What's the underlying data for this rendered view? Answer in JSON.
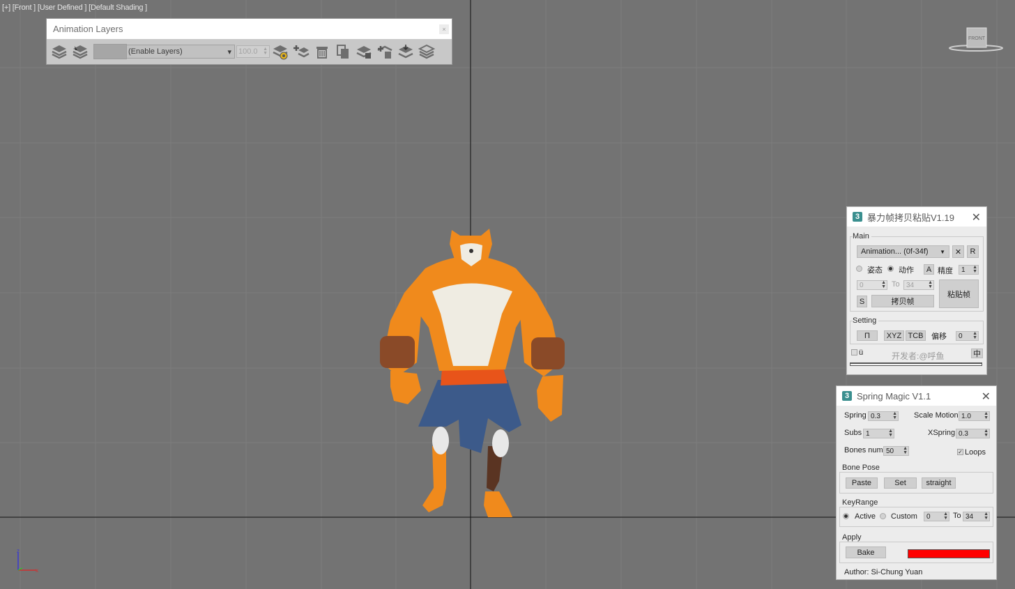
{
  "viewport": {
    "label_parts": [
      "[+]",
      "[Front ]",
      "[User Defined ]",
      "[Default Shading ]"
    ],
    "navcube_label": "FRONT",
    "axis": {
      "x": "x",
      "z": "z"
    }
  },
  "animation_layers": {
    "title": "Animation Layers",
    "close": "×",
    "layer_select": "(Enable Layers)",
    "weight": "100.0",
    "dropdown_arrow": "▾",
    "icons": [
      "enable-layers-icon",
      "select-layer-objects-icon",
      "layer-properties-icon",
      "add-layer-icon",
      "delete-layer-icon",
      "copy-layer-icon",
      "paste-active-icon",
      "paste-new-icon",
      "collapse-layer-icon",
      "disable-layers-icon"
    ]
  },
  "copy_panel": {
    "logo": "3",
    "title": "暴力帧拷贝粘贴V1.19",
    "close": "✕",
    "main": {
      "label": "Main",
      "dropdown": "Animation... (0f-34f)",
      "dropdown_arrow": "▼",
      "x_button": "✕",
      "r_button": "R",
      "radio_pose": "姿态",
      "radio_action": "动作",
      "a_button": "A",
      "precision_label": "精度",
      "precision_value": "1",
      "from_value": "0",
      "to_label": "To",
      "to_value": "34",
      "s_button": "S",
      "copy_button": "拷贝帧",
      "paste_button": "粘贴帧"
    },
    "setting": {
      "label": "Setting",
      "pi_button": "П",
      "xyz_button": "XYZ",
      "tcb_button": "TCB",
      "offset_label": "偏移",
      "offset_value": "0"
    },
    "footer": {
      "check_label": "ü",
      "developer": "开发者:@呼鱼",
      "lang_button": "中"
    }
  },
  "spring_magic": {
    "logo": "3",
    "title": "Spring Magic V1.1",
    "close": "✕",
    "spring_label": "Spring",
    "spring_value": "0.3",
    "scale_motion_label": "Scale Motion",
    "scale_motion_value": "1.0",
    "subs_label": "Subs",
    "subs_value": "1",
    "xspring_label": "XSpring",
    "xspring_value": "0.3",
    "bones_label": "Bones num",
    "bones_value": "50",
    "loops_label": "Loops",
    "loops_checked": true,
    "bone_pose": {
      "label": "Bone Pose",
      "paste": "Paste",
      "set": "Set",
      "straight": "straight"
    },
    "key_range": {
      "label": "KeyRange",
      "active": "Active",
      "custom": "Custom",
      "from": "0",
      "to_label": "To",
      "to": "34"
    },
    "apply": {
      "label": "Apply",
      "bake": "Bake",
      "progress_color": "#ff0000"
    },
    "author": "Author:  Si-Chung Yuan"
  },
  "colors": {
    "viewport_bg": "#737373",
    "grid_line": "#7e7e7e",
    "axis_line": "#111111",
    "tiger_orange": "#f08a1c",
    "shorts_blue": "#3c5a8a",
    "belt_orange": "#e8541a"
  }
}
